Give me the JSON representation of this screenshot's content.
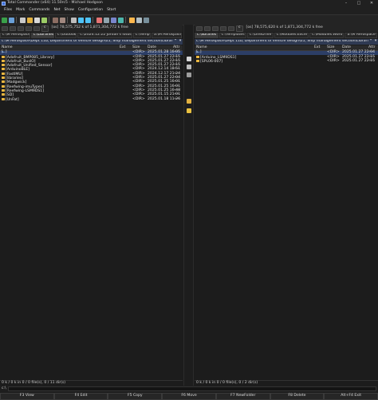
{
  "window": {
    "title": "Total Commander (x64) 11.50rc5 - Michael Hodgson",
    "min": "–",
    "max": "□",
    "close": "✕"
  },
  "menu": [
    "Files",
    "Mark",
    "Commands",
    "Net",
    "Show",
    "Configuration",
    "Start"
  ],
  "toolbar_icons": [
    "refresh-icon",
    "grid-icon",
    "list-icon",
    "tree-icon",
    "filter-icon",
    "sort-icon",
    "pack-icon",
    "unpack-icon",
    "search-icon",
    "back-icon",
    "forward-icon",
    "ftp-icon",
    "quickview-icon",
    "compare-icon",
    "sync-icon",
    "rename-icon",
    "notepad-icon",
    "settings-icon"
  ],
  "left": {
    "drive": "c",
    "free_info": "[os]  78,575,752 k of 1,871,304,772 k free",
    "tabs": [
      "c:\\M Aerospace",
      "c:\\Libraries",
      "c:\\Outlook",
      "c:\\2024.12.22 Jordan's lotus 7",
      "c:\\Temp",
      "a:\\M Aerospace"
    ],
    "active_tab": 1,
    "path": "c:\\M Aerospace\\Dept 11b, Department of vehicle design\\05, Ship management section\\Libraries\\*.*",
    "path_btn_star": "*",
    "path_btn_down": "▾",
    "columns": {
      "name": "Name",
      "ext": "Ext",
      "size": "Size",
      "date": "Date",
      "attr": "Attr"
    },
    "files": [
      {
        "name": "[..]",
        "ext": "",
        "size": "<DIR>",
        "date": "2025.01.28 16:05",
        "attr": "----"
      },
      {
        "name": "[Adafruit_BMP085_Library]",
        "ext": "",
        "size": "<DIR>",
        "date": "2025.01.27 22:15",
        "attr": "----"
      },
      {
        "name": "[Adafruit_BusIO]",
        "ext": "",
        "size": "<DIR>",
        "date": "2025.01.27 22:15",
        "attr": "----"
      },
      {
        "name": "[Adafruit_Unified_Sensor]",
        "ext": "",
        "size": "<DIR>",
        "date": "2025.01.27 22:15",
        "attr": "----"
      },
      {
        "name": "[ArduinoBLE]",
        "ext": "",
        "size": "<DIR>",
        "date": "2024.12.14 18:51",
        "attr": "----"
      },
      {
        "name": "[FastIMU]",
        "ext": "",
        "size": "<DIR>",
        "date": "2024.12.17 21:24",
        "attr": "----"
      },
      {
        "name": "[libraries]",
        "ext": "",
        "size": "<DIR>",
        "date": "2025.01.27 22:04",
        "attr": "----"
      },
      {
        "name": "[Madgwick]",
        "ext": "",
        "size": "<DIR>",
        "date": "2025.01.25 16:01",
        "attr": "----"
      },
      {
        "name": "[Reefwing-imuTypes]",
        "ext": "",
        "size": "<DIR>",
        "date": "2025.01.25 16:01",
        "attr": "----"
      },
      {
        "name": "[Reefwing-LSM9DS1]",
        "ext": "",
        "size": "<DIR>",
        "date": "2025.01.25 16:48",
        "attr": "----"
      },
      {
        "name": "[SD]",
        "ext": "",
        "size": "<DIR>",
        "date": "2025.01.15 21:01",
        "attr": "----"
      },
      {
        "name": "[UnFat]",
        "ext": "",
        "size": "<DIR>",
        "date": "2025.01.18 11:26",
        "attr": "----"
      }
    ],
    "status": "0 k / 0 k in 0 / 0 file(s), 0 / 11 dir(s)"
  },
  "right": {
    "drive": "c",
    "free_info": "[os]  78,575,620 k of 1,871,304,772 k free",
    "tabs": [
      "c:\\libraries",
      "c:\\Templates",
      "c:\\OneDrive",
      "c:\\Modules.Excel",
      "c:\\Modules.Word",
      "a:\\M Aerospace"
    ],
    "active_tab": 0,
    "path": "c:\\M Aerospace\\Dept 11b, Department of vehicle design\\05, Ship management section\\Libraries\\libraries\\*.*",
    "path_btn_star": "*",
    "path_btn_down": "▾",
    "columns": {
      "name": "Name",
      "ext": "Ext",
      "size": "Size",
      "date": "Date",
      "attr": "Attr"
    },
    "files": [
      {
        "name": "[..]",
        "ext": "",
        "size": "<DIR>",
        "date": "2025.01.27 22:04",
        "attr": "----"
      },
      {
        "name": "[Arduino_LSM9DS1]",
        "ext": "",
        "size": "<DIR>",
        "date": "2025.01.27 22:15",
        "attr": "----"
      },
      {
        "name": "[SPL06-007]",
        "ext": "",
        "size": "<DIR>",
        "date": "2025.01.27 22:15",
        "attr": "----"
      }
    ],
    "status": "0 k / 0 k in 0 / 0 file(s), 0 / 2 dir(s)"
  },
  "command_line": {
    "prompt": "c:\\"
  },
  "fkeys": [
    "F3 View",
    "F4 Edit",
    "F5 Copy",
    "F6 Move",
    "F7 NewFolder",
    "F8 Delete",
    "Alt+F4 Exit"
  ]
}
